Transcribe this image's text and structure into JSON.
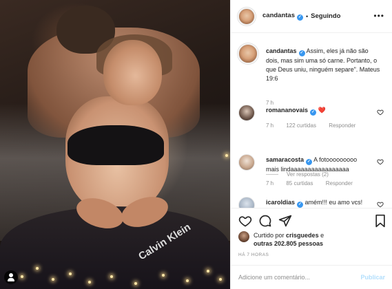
{
  "post": {
    "author": "candantas",
    "follow_state": "Seguindo",
    "more_label": "•••",
    "caption": {
      "author": "candantas",
      "text": "Assim, eles já não são dois, mas sim uma só carne. Portanto, o que Deus uniu, ninguém separe\". Mateus 19:6",
      "time": "7 h"
    },
    "comments": [
      {
        "author": "romananovais",
        "text": "❤️",
        "time": "7 h",
        "likes": "122 curtidas",
        "reply_label": "Responder",
        "view_replies": "Ver respostas (2)"
      },
      {
        "author": "samaracosta",
        "text": "A fotooooooooo mais lindaaaaaaaaaaaaaaaaa",
        "time": "7 h",
        "likes": "85 curtidas",
        "reply_label": "Responder"
      },
      {
        "author": "icaroldias",
        "text": "amém!!! eu amo vcs!"
      }
    ],
    "liked_by": {
      "prefix": "Curtido por",
      "user": "crisguedes",
      "connector": "e",
      "others": "outras 202.805 pessoas"
    },
    "time_ago": "HÁ 7 HORAS",
    "comment_box": {
      "placeholder": "Adicione um comentário...",
      "publish_label": "Publicar"
    },
    "photo_text": "Calvin Klein"
  },
  "colors": {
    "verified": "#3897f0",
    "heart": "#ed4956",
    "publish_disabled": "#b2dffc",
    "muted": "#8e8e8e"
  }
}
